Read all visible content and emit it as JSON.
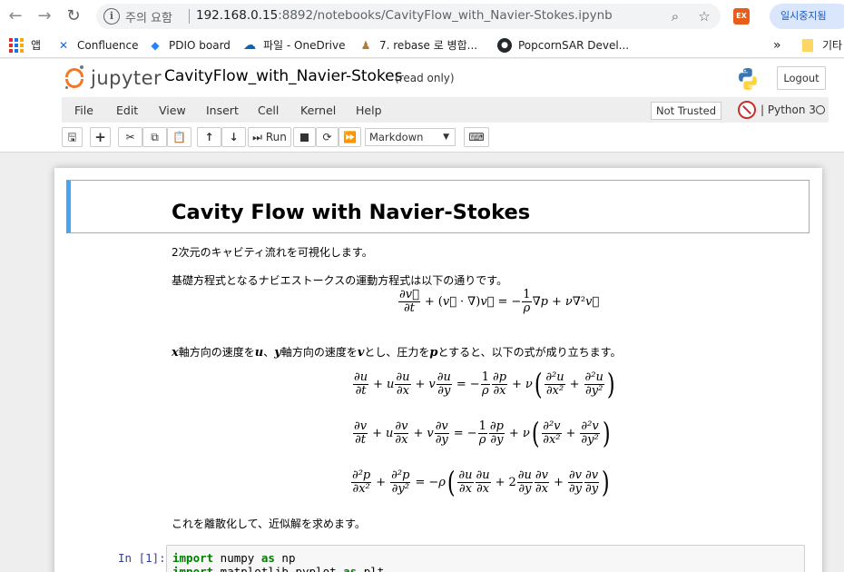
{
  "browser": {
    "security_label": "주의 요함",
    "url_host": "192.168.0.15",
    "url_rest": ":8892/notebooks/CavityFlow_with_Navier-Stokes.ipynb",
    "pause_label": "일시중지됨",
    "extension_label": "EX",
    "bookmarks": [
      {
        "label": "앱",
        "icon": "apps-grid-icon"
      },
      {
        "label": "Confluence",
        "icon": "confluence-icon"
      },
      {
        "label": "PDIO board",
        "icon": "diamond-icon"
      },
      {
        "label": "파일 - OneDrive",
        "icon": "cloud-icon"
      },
      {
        "label": "7. rebase 로 병합...",
        "icon": "git-icon"
      },
      {
        "label": "PopcornSAR Devel...",
        "icon": "github-icon"
      }
    ],
    "more_label": "»",
    "other_bookmarks": "기타"
  },
  "jupyter": {
    "logo_text": "jupyter",
    "notebook_name": "CavityFlow_with_Navier-Stokes",
    "read_only": "(read only)",
    "logout_label": "Logout",
    "menu": [
      "File",
      "Edit",
      "View",
      "Insert",
      "Cell",
      "Kernel",
      "Help"
    ],
    "trust_label": "Not Trusted",
    "kernel_name": "Python 3",
    "run_label": "Run",
    "cell_type": "Markdown"
  },
  "cell": {
    "title": "Cavity Flow with Navier-Stokes",
    "intro": "2次元のキャビティ流れを可視化します。",
    "base_eq_text": "基礎方程式となるナビエストークスの運動方程式は以下の通りです。",
    "xy_text": {
      "x": "x",
      "t1": "軸方向の速度を",
      "u": "u",
      "t2": "、",
      "y": "y",
      "t3": "軸方向の速度を",
      "v": "v",
      "t4": "とし、圧力を",
      "p": "p",
      "t5": "とすると、以下の式が成り立ちます。"
    },
    "discretize_text": "これを離散化して、近似解を求めます。"
  },
  "code": {
    "prompt": "In [1]:",
    "line1_kw": "import",
    "line1_mod": " numpy ",
    "line1_as": "as",
    "line1_alias": " np",
    "line2_kw": "import",
    "line2_mod": " matplotlib.pyplot ",
    "line2_as": "as",
    "line2_alias": " plt"
  }
}
